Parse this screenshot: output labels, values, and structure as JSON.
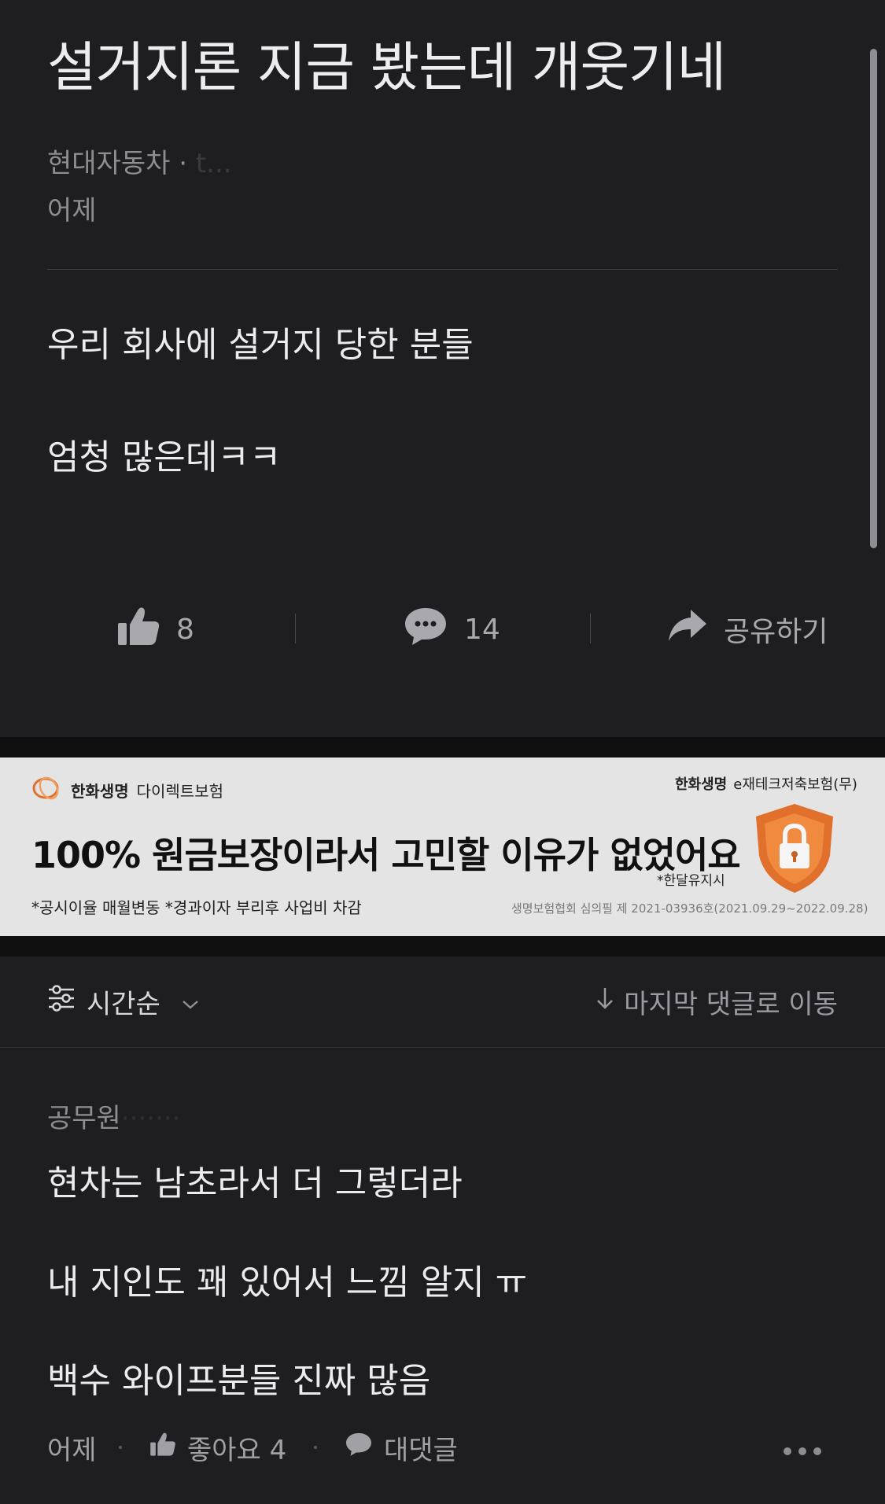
{
  "post": {
    "title": "설거지론 지금 봤는데 개웃기네",
    "company": "현대자동차 · ",
    "author_blurred": "t...",
    "time": "어제",
    "body": [
      "우리 회사에 설거지 당한 분들",
      "엄청 많은데ㅋㅋ"
    ],
    "likes": "8",
    "comments": "14",
    "share_label": "공유하기"
  },
  "ad": {
    "brand": "한화생명",
    "brand_sub": "다이렉트보험",
    "top_right_brand": "한화생명",
    "top_right_product": "e재테크저축보험(무)",
    "headline": "100% 원금보장이라서 고민할 이유가 없었어요",
    "note": "*한달유지시",
    "footnote": "*공시이율 매월변동 *경과이자 부리후 사업비 차감",
    "registration": "생명보험협회 심의필 제 2021-03936호(2021.09.29~2022.09.28)",
    "colors": {
      "shield": "#e0702c",
      "shield_inner": "#f08a3e"
    }
  },
  "sort": {
    "label": "시간순",
    "jump_label": "마지막 댓글로 이동"
  },
  "comment": {
    "company": "공무원",
    "author_blurred": "·······",
    "lines": [
      "현차는 남초라서 더 그렇더라",
      "내 지인도 꽤 있어서 느낌 알지 ㅠ",
      "백수 와이프분들 진짜 많음"
    ],
    "time": "어제",
    "like_label": "좋아요 4",
    "reply_label": "대댓글"
  },
  "colors": {
    "background": "#1e1e20",
    "separator": "#0f0f10",
    "text": "#ececee",
    "muted": "#8d8d92"
  }
}
